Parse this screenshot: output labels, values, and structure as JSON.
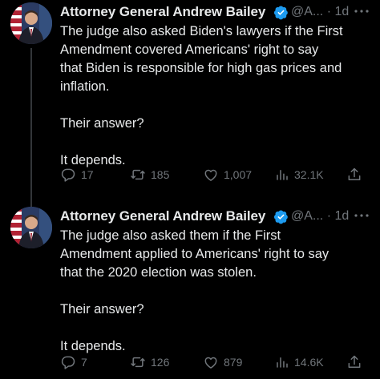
{
  "tweets": [
    {
      "author": "Attorney General Andrew Bailey",
      "handle": "@A...",
      "time": "· 1d",
      "lines": [
        "The judge also asked Biden's lawyers if the First",
        "Amendment covered Americans' right to say",
        "that Biden is responsible for high gas prices and",
        "inflation."
      ],
      "para2": "Their answer?",
      "para3": "It depends.",
      "stats": {
        "replies": "17",
        "reposts": "185",
        "likes": "1,007",
        "views": "32.1K"
      }
    },
    {
      "author": "Attorney General Andrew Bailey",
      "handle": "@A...",
      "time": "· 1d",
      "lines": [
        "The judge also asked them if the First",
        "Amendment applied to Americans' right to say",
        "that the 2020 election was stolen."
      ],
      "para2": "Their answer?",
      "para3": "It depends.",
      "stats": {
        "replies": "7",
        "reposts": "126",
        "likes": "879",
        "views": "14.6K"
      }
    }
  ],
  "icons": {
    "verified": "verified-badge-icon",
    "more": "more-horizontal-icon",
    "reply": "reply-icon",
    "repost": "repost-icon",
    "like": "heart-icon",
    "views": "views-bar-chart-icon",
    "share": "share-icon"
  },
  "colors": {
    "background": "#000000",
    "text": "#e7e9ea",
    "muted": "#71767b",
    "verified": "#1d9bf0",
    "thread_line": "#333639"
  }
}
